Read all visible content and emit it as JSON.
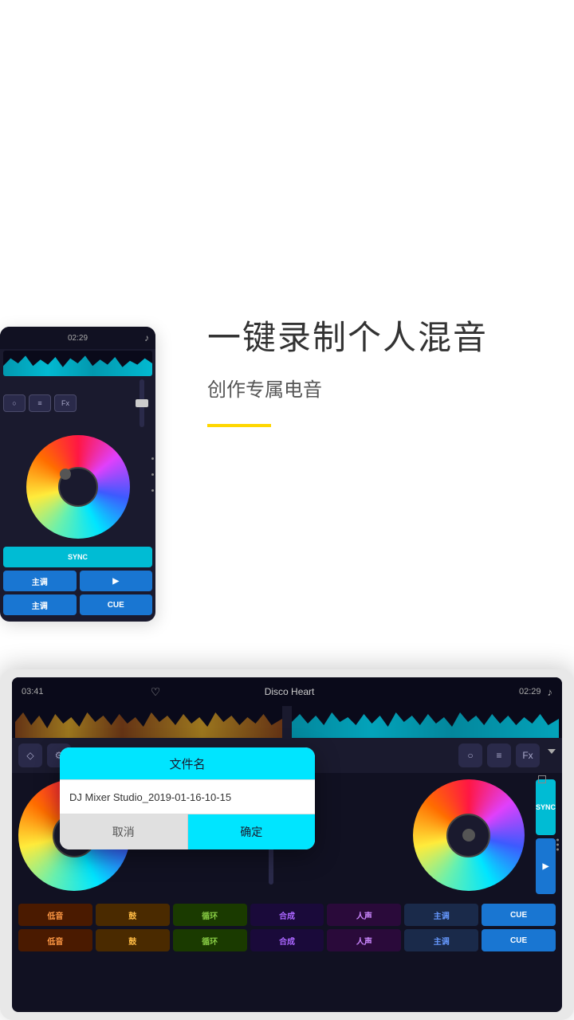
{
  "decorations": {
    "blob_top_left": "yellow blob top left",
    "blob_top_right": "yellow blob top right"
  },
  "top_section": {
    "headline": "一键录制个人混音",
    "subtitle": "创作专属电音",
    "yellow_line": true
  },
  "device1": {
    "time": "02:29",
    "controls": {
      "btn1": "○",
      "btn2": "≡",
      "btn3": "Fx"
    },
    "buttons": {
      "sync": "SYNC",
      "key1": "主调",
      "play": "▶",
      "key2": "主调",
      "cue": "CUE"
    }
  },
  "device2": {
    "time_left": "03:41",
    "track_name": "Disco Heart",
    "time_right": "02:29",
    "controls": {
      "icon1": "◇",
      "icon2": "⚙",
      "icon3": "○",
      "icon4": "≡",
      "icon5": "Fx"
    },
    "dialog": {
      "title": "文件名",
      "input_value": "DJ Mixer Studio_2019-01-16-10-15",
      "cancel": "取消",
      "confirm": "确定"
    },
    "bottom_row1": {
      "bass": "低音",
      "drum": "鼓",
      "loop": "循环",
      "synth": "合成",
      "vocal": "人声",
      "key": "主调",
      "sync": "SYNC",
      "play": "▶",
      "cue": "CUE"
    },
    "bottom_row2": {
      "bass": "低音",
      "drum": "鼓",
      "loop": "循环",
      "synth": "合成",
      "vocal": "人声",
      "key": "主调",
      "cue": "CUE"
    }
  }
}
